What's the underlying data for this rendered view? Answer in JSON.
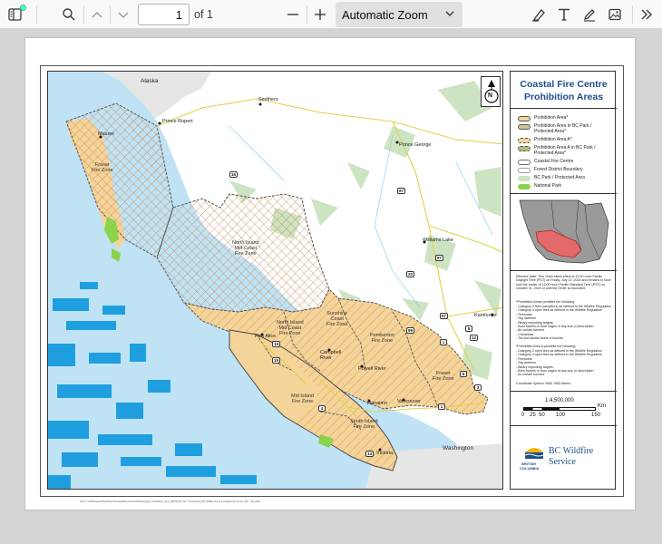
{
  "toolbar": {
    "sidebar_toggle": "Toggle Sidebar",
    "find": "Find",
    "prev": "Previous",
    "next": "Next",
    "page_number": "1",
    "page_total": "of 1",
    "zoom_out": "Zoom Out",
    "zoom_in": "Zoom In",
    "zoom_value": "Automatic Zoom",
    "highlight": "Highlight",
    "text": "Text",
    "draw": "Draw",
    "image": "Add image",
    "more": "Tools"
  },
  "map": {
    "title_line1": "Coastal Fire Centre",
    "title_line2": "Prohibition Areas",
    "places": {
      "alaska": "Alaska",
      "smithers": "Smithers",
      "prince_rupert": "Prince Rupert",
      "prince_george": "Prince George",
      "masset": "Masset",
      "williams_lake": "Williams Lake",
      "kamloops": "Kamloops",
      "port_alice": "Port Alice",
      "campbell_river": "Campbell\nRiver",
      "powell_river": "Powell River",
      "nanaimo": "Nanaimo",
      "vancouver": "Vancouver",
      "victoria": "Victoria",
      "washington": "Washington"
    },
    "zones": {
      "fraser_fire_zone_north": "Fraser\nFire Zone",
      "north_island_mid_coast": "North Island\nMid Coast\nFire Zone",
      "north_island_mid_coast_2": "North Island\nMid Coast\nFire Zone",
      "sunshine_coast": "Sunshine\nCoast\nFire Zone",
      "pemberton": "Pemberton\nFire Zone",
      "fraser_fire_zone_south": "Fraser\nFire Zone",
      "mid_island": "Mid Island\nFire Zone",
      "south_island": "South Island\nFire Zone"
    },
    "highways": [
      "16",
      "97",
      "97",
      "20",
      "97",
      "5",
      "1",
      "99",
      "19",
      "19",
      "4",
      "12",
      "5",
      "3",
      "1",
      "14"
    ],
    "north_arrow": "N"
  },
  "legend": {
    "items": [
      "Prohibition Area*",
      "Prohibition Area in BC Park / Protected Area*",
      "Prohibition Area A*",
      "Prohibition Area A in BC Park / Protected Area*",
      "Coastal Fire Centre",
      "Forest District Boundary",
      "BC Park / Protected Area",
      "National Park"
    ],
    "colors": {
      "prohibition": "#f5d49a",
      "prohibition_park": "#c9c98e",
      "prohibition_a": "#f5d49a",
      "prohibition_a_park": "#b9b97f",
      "park": "#cde4c2",
      "national_park": "#8bd34a",
      "fire_centre_line": "#6b6b6b",
      "district_line": "#777777",
      "water": "#bfe3f5",
      "deep_water": "#1f9fe0",
      "land": "#ffffff",
      "zone_line": "#444444"
    },
    "effective_text": "Effective Date: This Order takes effect at 12:00 noon Pacific Daylight Time (PDT) on Friday, July 12, 2024 and remains in force until the earlier of 12:00 noon Pacific Standard Time (PST) on October 31, 2024 or until the Order is rescinded.",
    "prohibition_area_heading": "*Prohibition Areas prohibits the following:",
    "prohibition_area_items": [
      "- Category 2 fires (campfires) as defined in the Wildfire Regulation",
      "- Category 3 open fires as defined in the Wildfire Regulation",
      "- Fireworks",
      "- Sky lanterns",
      "- Binary exploding targets",
      "- Burn barrels or burn cages of any size or description",
      "- Air curtain burners",
      "- Chimineas",
      "- Tiki and similar kinds of torches"
    ],
    "prohibition_a_heading": "*Prohibition Area A prohibits the following:",
    "prohibition_a_items": [
      "- Category 2 open fires as defined in the Wildfire Regulation",
      "- Category 3 open fires as defined in the Wildfire Regulation",
      "- Fireworks",
      "- Sky lanterns",
      "- Binary exploding targets",
      "- Burn barrels or burn cages of any size or description",
      "- Air curtain burners"
    ],
    "coordinate_system": "Coordinate System: NAD 1983 Albers",
    "scale": "1:4,500,000",
    "scale_ticks": [
      "0",
      "25",
      "50",
      "100",
      "150"
    ],
    "scale_unit": "Km",
    "logo_left_line1": "BRITISH",
    "logo_left_line2": "COLUMBIA",
    "logo_right_line1": "BC Wildfire",
    "logo_right_line2": "Service"
  },
  "footer_text": "Path: F:\\GIS\\Projects\\Prohibitions\\CoastalFireCentre\\2024\\Campfire_Prohibition_CFC_20240712.mxd - Produced by BC Wildfire Service Coastal Fire Centre GIS - July 2024"
}
